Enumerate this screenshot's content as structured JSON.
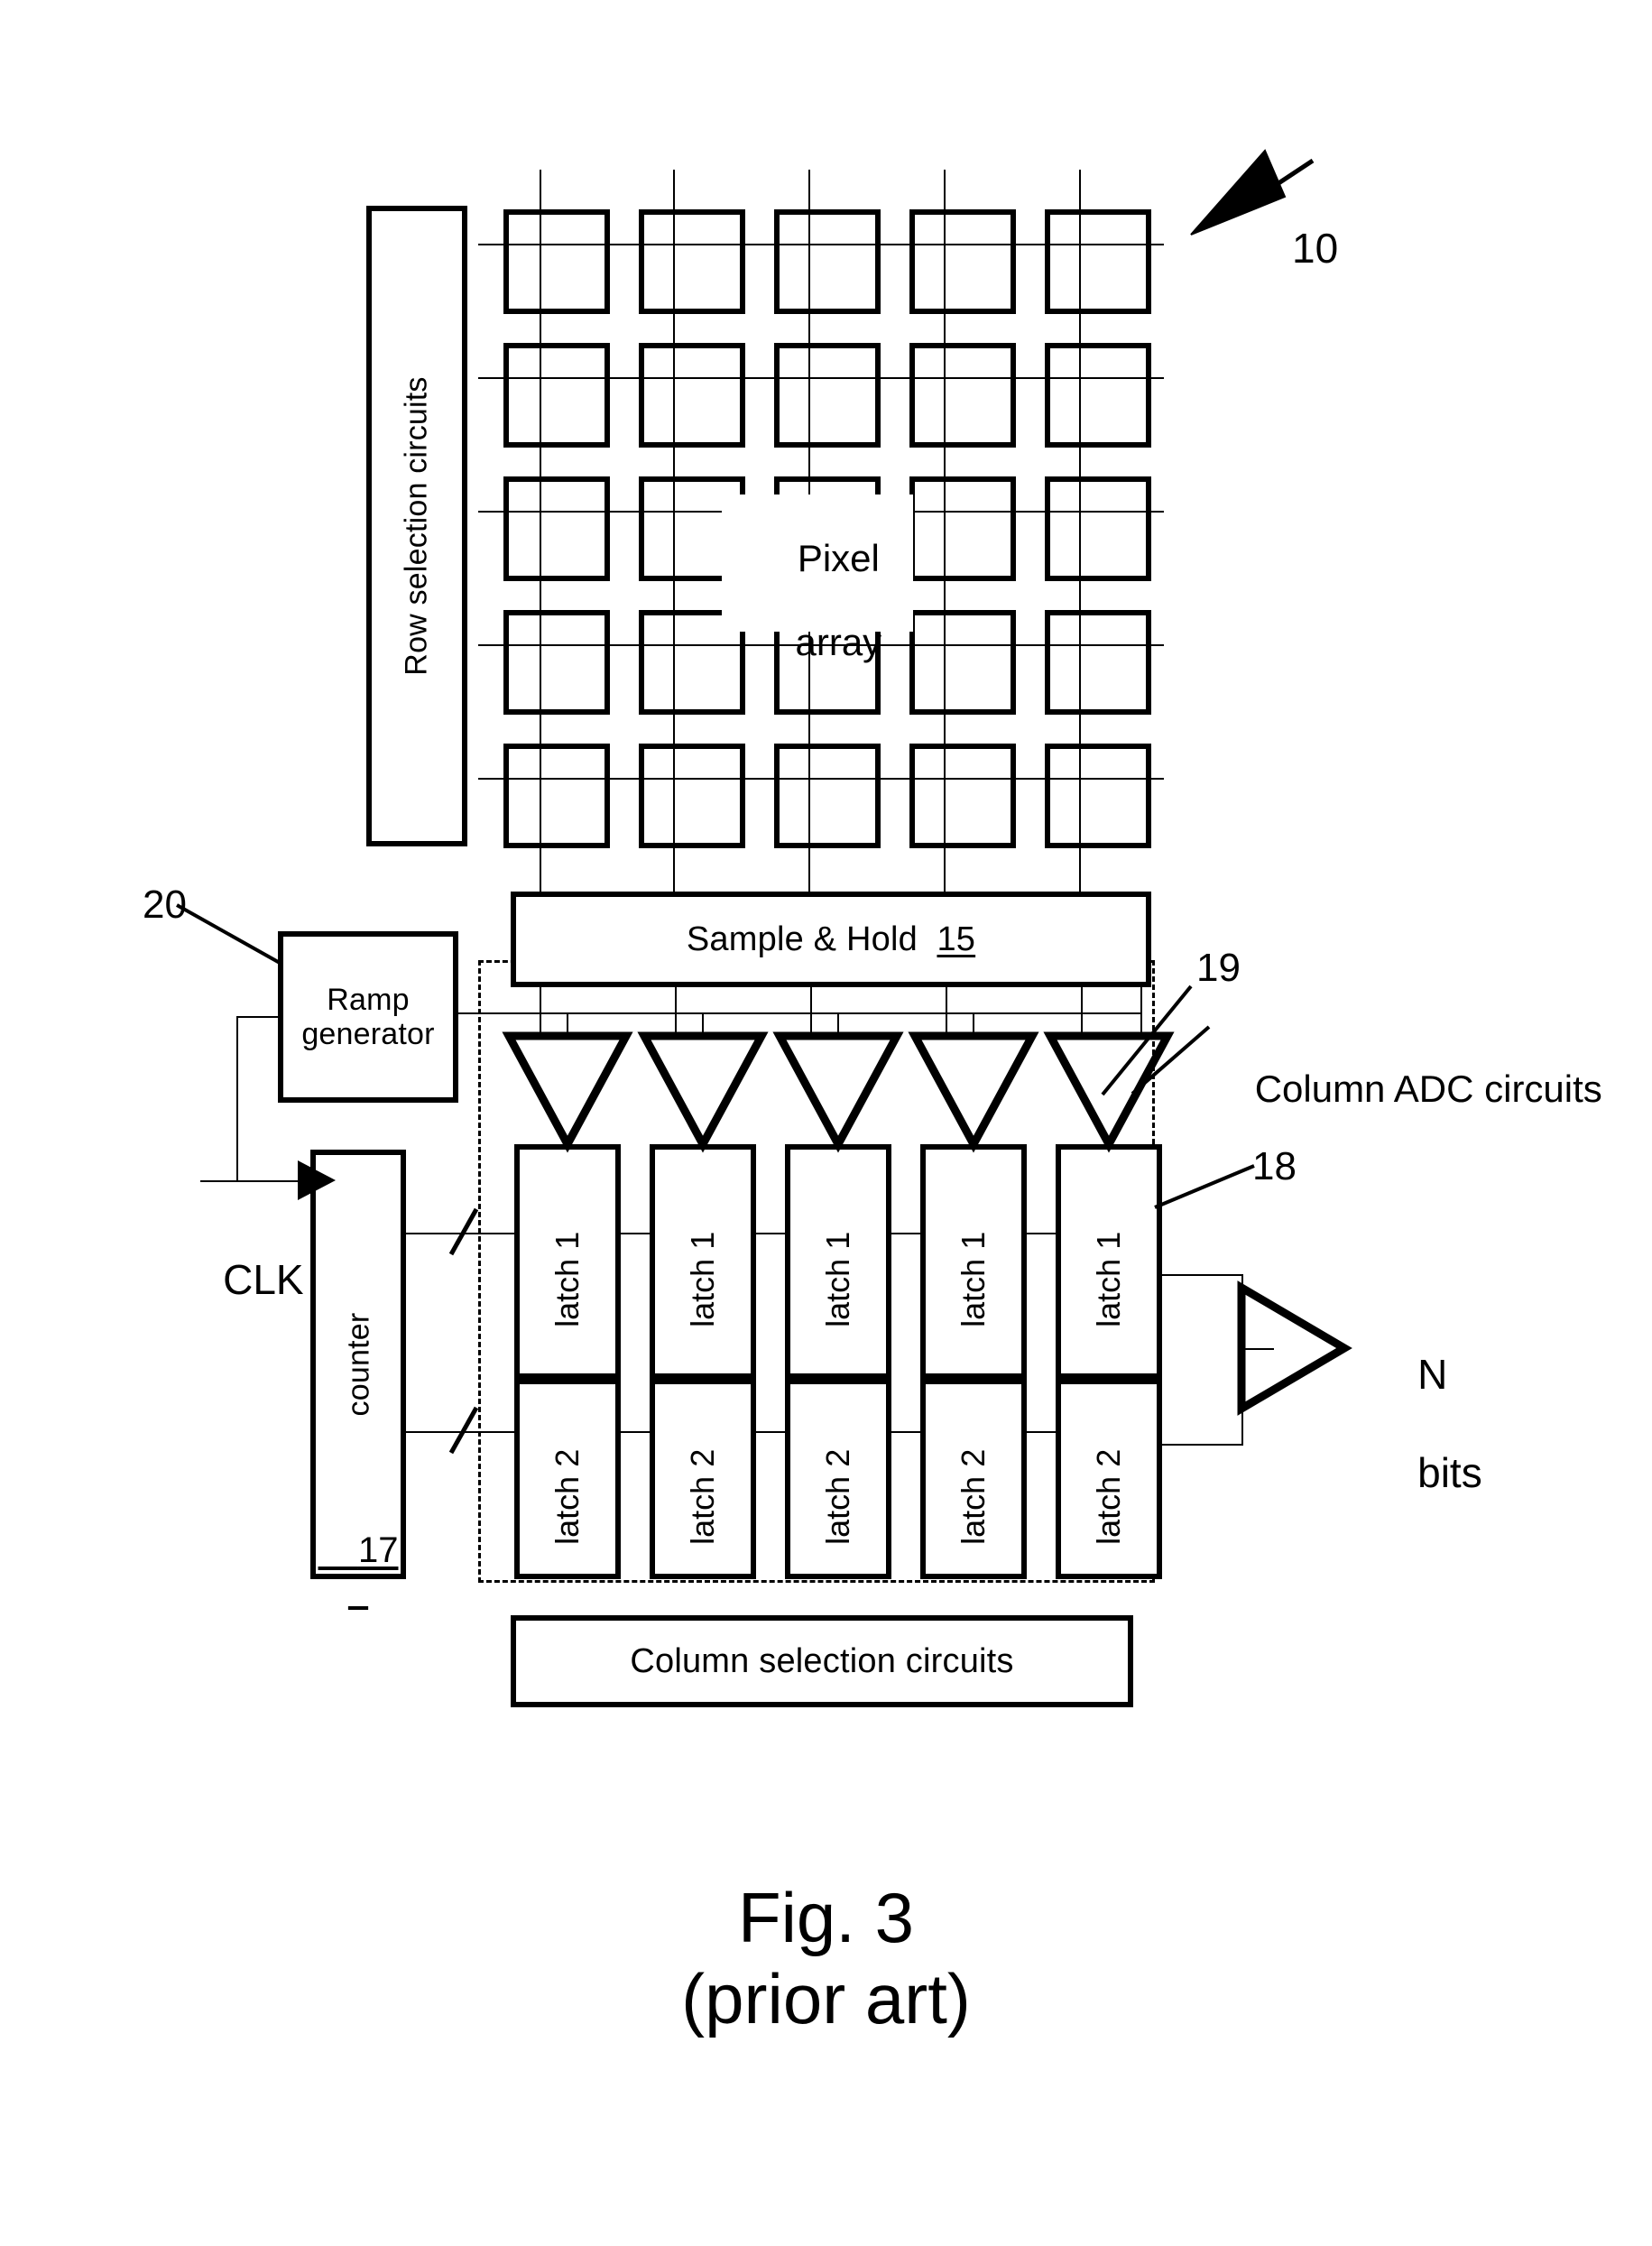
{
  "figure": {
    "caption_line1": "Fig. 3",
    "caption_line2": "(prior art)"
  },
  "blocks": {
    "row_selection": {
      "label": "Row selection circuits"
    },
    "pixel_array": {
      "label_line1": "Pixel",
      "label_line2": "array",
      "rows": 5,
      "cols": 5
    },
    "sample_hold": {
      "label": "Sample & Hold",
      "ref": "15"
    },
    "ramp_generator": {
      "label_line1": "Ramp",
      "label_line2": "generator",
      "ref": "20"
    },
    "counter": {
      "label": "counter",
      "ref": "17"
    },
    "column_selection": {
      "label": "Column selection circuits"
    },
    "column_adc": {
      "label": "Column ADC circuits",
      "ref": "19"
    },
    "latch1": {
      "label": "latch 1",
      "ref": "18",
      "count": 5
    },
    "latch2": {
      "label": "latch 2",
      "count": 5
    },
    "comparators": {
      "count": 5
    }
  },
  "signals": {
    "clk": "CLK",
    "output_line1": "N",
    "output_line2": "bits"
  },
  "references": {
    "device": "10",
    "sample_hold": "15",
    "counter": "17",
    "latch": "18",
    "adc": "19",
    "ramp": "20"
  }
}
